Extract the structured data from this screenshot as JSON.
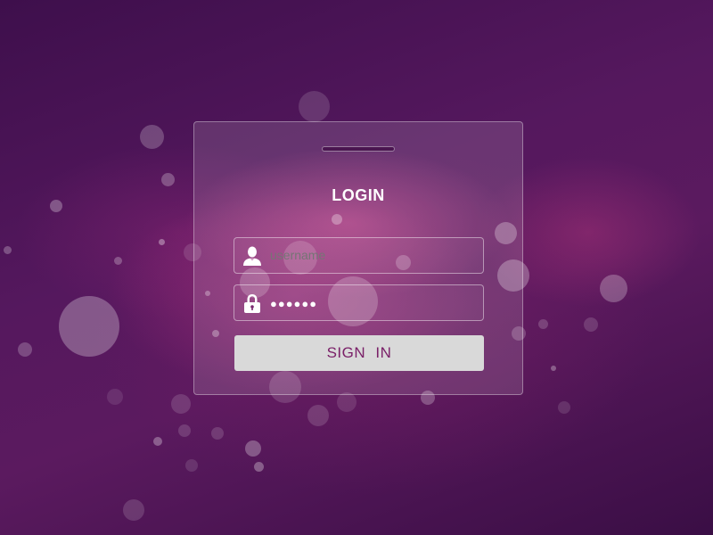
{
  "login": {
    "title": "LOGIN",
    "username_placeholder": "username",
    "password_mask": "●●●●●●",
    "signin_label": "SIGN  IN"
  },
  "colors": {
    "background": "#4e1558",
    "button_bg": "#d9d9d9",
    "button_text": "#7a2068",
    "text": "#ffffff"
  },
  "icons": {
    "username_icon": "user-icon",
    "password_icon": "lock-icon"
  }
}
